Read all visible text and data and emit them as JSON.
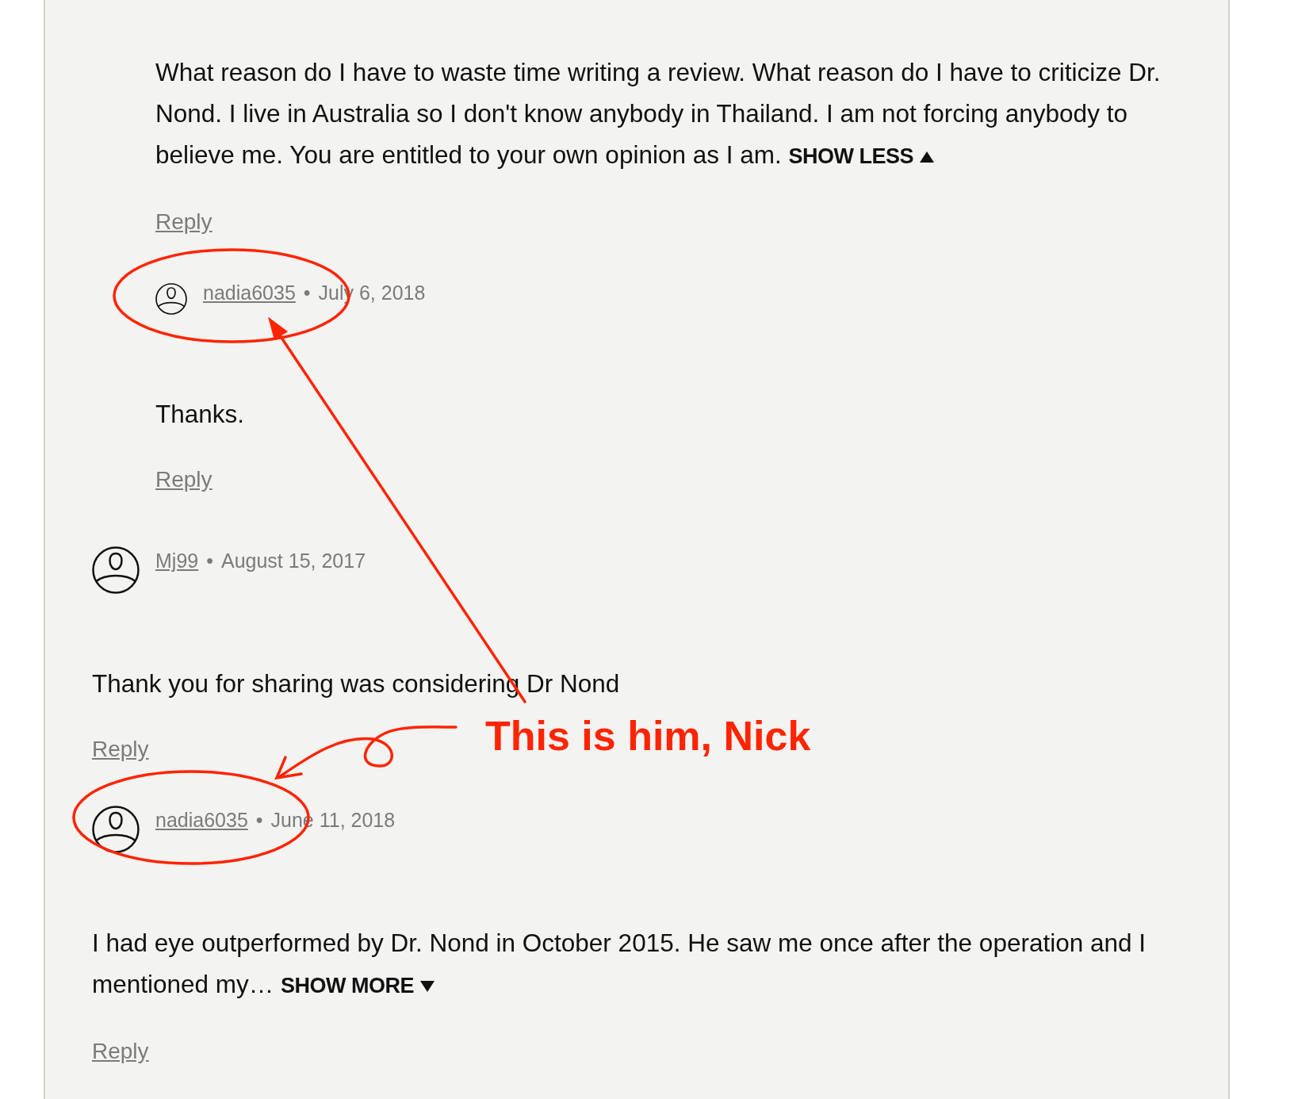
{
  "thread": [
    {
      "kind": "nested",
      "text": "What reason do I have to waste time writing a review. What reason do I have to criticize Dr. Nond. I live in Australia so I don't know anybody in Thailand. I am not forcing anybody to believe me. You are entitled to your own opinion as I am.",
      "toggle": {
        "label": "SHOW LESS",
        "expanded": true
      },
      "reply": "Reply"
    },
    {
      "kind": "nested",
      "author": "nadia6035",
      "separator": "•",
      "date": "July 6, 2018",
      "text": "Thanks.",
      "reply": "Reply"
    },
    {
      "kind": "top",
      "author": "Mj99",
      "separator": "•",
      "date": "August 15, 2017",
      "text": "Thank you for sharing was considering Dr Nond",
      "reply": "Reply"
    },
    {
      "kind": "top",
      "author": "nadia6035",
      "separator": "•",
      "date": "June 11, 2018",
      "text": "I had eye outperformed by Dr. Nond in October 2015. He saw me once after the operation and I mentioned my…",
      "toggle": {
        "label": "SHOW MORE",
        "expanded": false
      },
      "reply": "Reply"
    }
  ],
  "annotation": {
    "note": "This is him, Nick"
  }
}
